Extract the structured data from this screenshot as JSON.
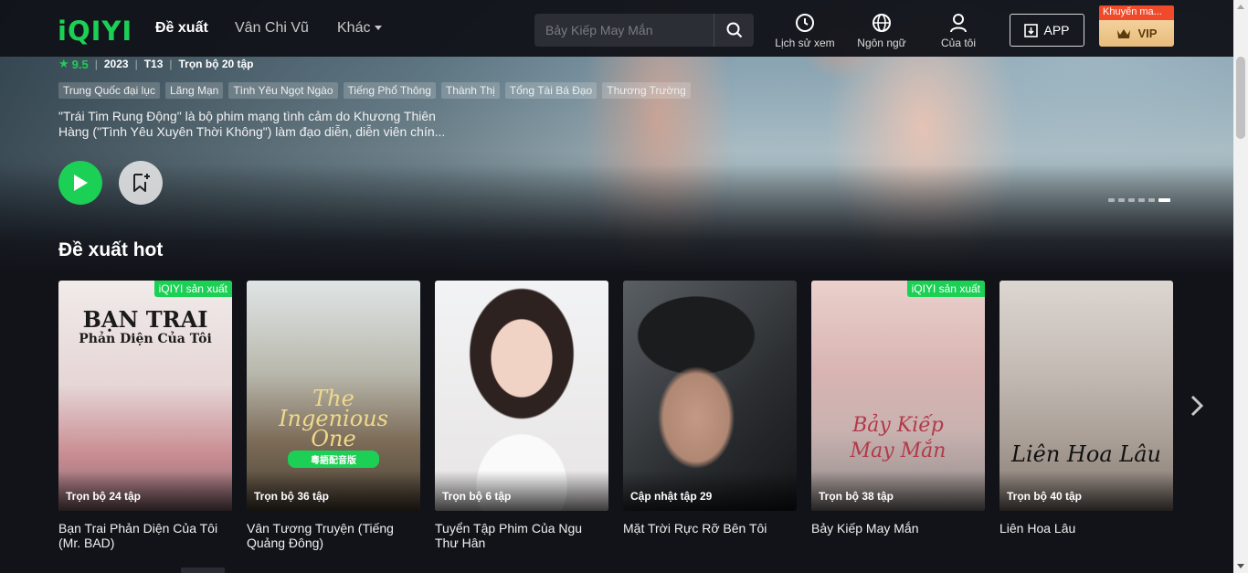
{
  "header": {
    "logo": "iQIYI",
    "nav": [
      {
        "label": "Đề xuất",
        "active": true
      },
      {
        "label": "Vân Chi Vũ",
        "active": false
      },
      {
        "label": "Khác",
        "active": false
      }
    ],
    "search_placeholder": "Bảy Kiếp May Mắn",
    "icons": [
      {
        "label": "Lịch sử xem",
        "icon": "history-icon"
      },
      {
        "label": "Ngôn ngữ",
        "icon": "globe-icon"
      },
      {
        "label": "Của tôi",
        "icon": "user-icon"
      }
    ],
    "app_label": "APP",
    "vip_label": "VIP",
    "promo_label": "Khuyến ma..."
  },
  "hero": {
    "rating": "9.5",
    "year": "2023",
    "age": "T13",
    "episodes": "Trọn bộ 20 tập",
    "tags": [
      "Trung Quốc đại lục",
      "Lãng Mạn",
      "Tình Yêu Ngọt Ngào",
      "Tiếng Phổ Thông",
      "Thành Thị",
      "Tổng Tài Bá Đạo",
      "Thương Trường"
    ],
    "description": "\"Trái Tim Rung Động\" là bộ phim mạng tình cảm do Khương Thiên Hàng (\"Tình Yêu Xuyên Thời Không\") làm đạo diễn, diễn viên chín...",
    "slide_count": 6,
    "active_slide": 6
  },
  "section": {
    "title": "Đề xuất hot",
    "cards": [
      {
        "title": "Bạn Trai Phản Diện Của Tôi (Mr. BAD)",
        "episode": "Trọn bộ 24 tập",
        "badge": "iQIYI sản xuất",
        "poster_text": "BẠN TRAI",
        "poster_sub": "Phản Diện Của Tôi",
        "colors": [
          "#ece6e4",
          "#d9a7a4"
        ]
      },
      {
        "title": "Vân Tương Truyện (Tiếng Quảng Đông)",
        "episode": "Trọn bộ 36 tập",
        "badge": "",
        "poster_text": "The Ingenious One",
        "poster_sub": "粵語配音版",
        "colors": [
          "#c8d1d2",
          "#7d6e5c"
        ]
      },
      {
        "title": "Tuyển Tập Phim Của Ngu Thư Hân",
        "episode": "Trọn bộ 6 tập",
        "badge": "",
        "poster_text": "",
        "poster_sub": "",
        "colors": [
          "#f2f2f4",
          "#dcd8d8"
        ]
      },
      {
        "title": "Mặt Trời Rực Rỡ Bên Tôi",
        "episode": "Cập nhật tập 29",
        "badge": "",
        "poster_text": "",
        "poster_sub": "",
        "colors": [
          "#4a4f55",
          "#1e2226"
        ]
      },
      {
        "title": "Bảy Kiếp May Mắn",
        "episode": "Trọn bộ 38 tập",
        "badge": "iQIYI sản xuất",
        "poster_text": "Bảy Kiếp",
        "poster_sub": "May Mắn",
        "colors": [
          "#e8c7c6",
          "#b79b96"
        ]
      },
      {
        "title": "Liên Hoa Lâu",
        "episode": "Trọn bộ 40 tập",
        "badge": "",
        "poster_text": "Liên Hoa Lâu",
        "poster_sub": "",
        "colors": [
          "#d3cdc8",
          "#a39a92"
        ]
      }
    ]
  },
  "colors": {
    "accent": "#1ccf55",
    "background": "#111319",
    "promo": "#f04a2a",
    "vip_gold": "#e8bc7b"
  }
}
